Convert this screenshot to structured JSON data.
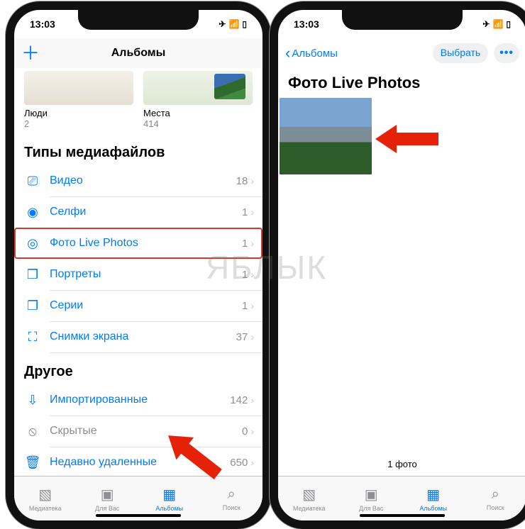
{
  "status": {
    "time": "13:03",
    "icons": [
      "✈︎",
      "📶",
      "▯"
    ]
  },
  "watermark": "ЯБЛЫК",
  "left": {
    "nav": {
      "title": "Альбомы",
      "add": "＋"
    },
    "people_places": {
      "people": {
        "label": "Люди",
        "count": "2"
      },
      "places": {
        "label": "Места",
        "count": "414"
      }
    },
    "section_media": "Типы медиафайлов",
    "media": [
      {
        "key": "video",
        "icon": "⎚",
        "label": "Видео",
        "count": "18"
      },
      {
        "key": "selfie",
        "icon": "◉",
        "label": "Селфи",
        "count": "1"
      },
      {
        "key": "livephotos",
        "icon": "◎",
        "label": "Фото Live Photos",
        "count": "1",
        "highlight": true
      },
      {
        "key": "portraits",
        "icon": "❒",
        "label": "Портреты",
        "count": "1"
      },
      {
        "key": "bursts",
        "icon": "❐",
        "label": "Серии",
        "count": "1"
      },
      {
        "key": "screenshots",
        "icon": "⛶",
        "label": "Снимки экрана",
        "count": "37"
      }
    ],
    "section_other": "Другое",
    "other": [
      {
        "key": "imported",
        "icon": "⇩",
        "label": "Импортированные",
        "count": "142"
      },
      {
        "key": "hidden",
        "icon": "⦸",
        "label": "Скрытые",
        "count": "0",
        "gray": true
      },
      {
        "key": "recent-del",
        "icon": "🗑",
        "label": "Недавно удаленные",
        "count": "650"
      }
    ]
  },
  "right": {
    "nav": {
      "back": "Альбомы",
      "select": "Выбрать",
      "more": "•••"
    },
    "title": "Фото Live Photos",
    "footer": "1 фото"
  },
  "tabs": [
    {
      "key": "library",
      "icon": "▧",
      "label": "Медиатека"
    },
    {
      "key": "foryou",
      "icon": "▣",
      "label": "Для Вас"
    },
    {
      "key": "albums",
      "icon": "▦",
      "label": "Альбомы",
      "active": true
    },
    {
      "key": "search",
      "icon": "⌕",
      "label": "Поиск"
    }
  ]
}
